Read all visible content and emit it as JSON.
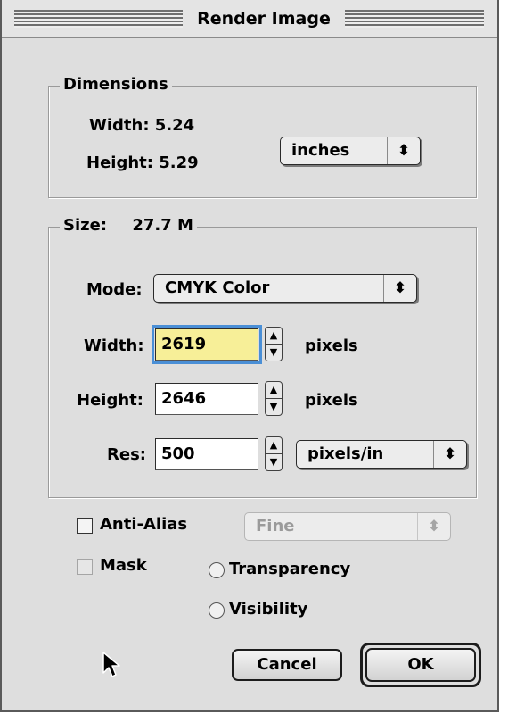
{
  "window": {
    "title": "Render Image"
  },
  "dimensions": {
    "legend": "Dimensions",
    "width_label": "Width: 5.24",
    "height_label": "Height: 5.29",
    "unit_popup": "inches"
  },
  "size": {
    "legend_label": "Size:",
    "legend_value": "27.7 M",
    "mode_label": "Mode:",
    "mode_value": "CMYK Color",
    "width_label": "Width:",
    "width_value": "2619",
    "width_unit": "pixels",
    "height_label": "Height:",
    "height_value": "2646",
    "height_unit": "pixels",
    "res_label": "Res:",
    "res_value": "500",
    "res_unit_popup": "pixels/in"
  },
  "options": {
    "anti_alias_label": "Anti-Alias",
    "anti_alias_quality": "Fine",
    "mask_label": "Mask",
    "transparency_label": "Transparency",
    "visibility_label": "Visibility"
  },
  "buttons": {
    "cancel": "Cancel",
    "ok": "OK"
  },
  "icons": {
    "popup_arrows": "updown-arrows-icon",
    "stepper": "stepper-arrows-icon",
    "cursor": "arrow-cursor-icon"
  }
}
